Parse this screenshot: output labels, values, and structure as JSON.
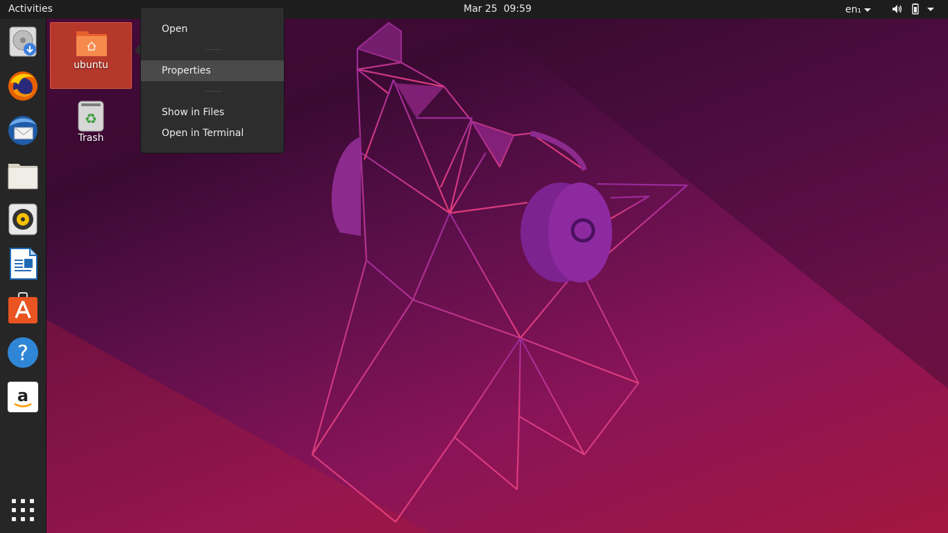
{
  "topbar": {
    "activities": "Activities",
    "date": "Mar 25",
    "time": "09:59",
    "language": "en₁"
  },
  "dock": {
    "items": [
      {
        "name": "disk-installer-icon"
      },
      {
        "name": "firefox-icon"
      },
      {
        "name": "thunderbird-icon"
      },
      {
        "name": "files-icon"
      },
      {
        "name": "rhythmbox-icon"
      },
      {
        "name": "libreoffice-writer-icon"
      },
      {
        "name": "software-center-icon"
      },
      {
        "name": "help-icon"
      },
      {
        "name": "amazon-icon"
      }
    ]
  },
  "desktop": {
    "home_label": "ubuntu",
    "trash_label": "Trash"
  },
  "context_menu": {
    "items": [
      "Open",
      "Properties",
      "Show in Files",
      "Open in Terminal"
    ],
    "highlighted": "Properties"
  },
  "colors": {
    "accent": "#b5382b",
    "menu_bg": "#2d2d2d",
    "topbar_bg": "#1d1d1d",
    "dock_bg": "#262626"
  }
}
